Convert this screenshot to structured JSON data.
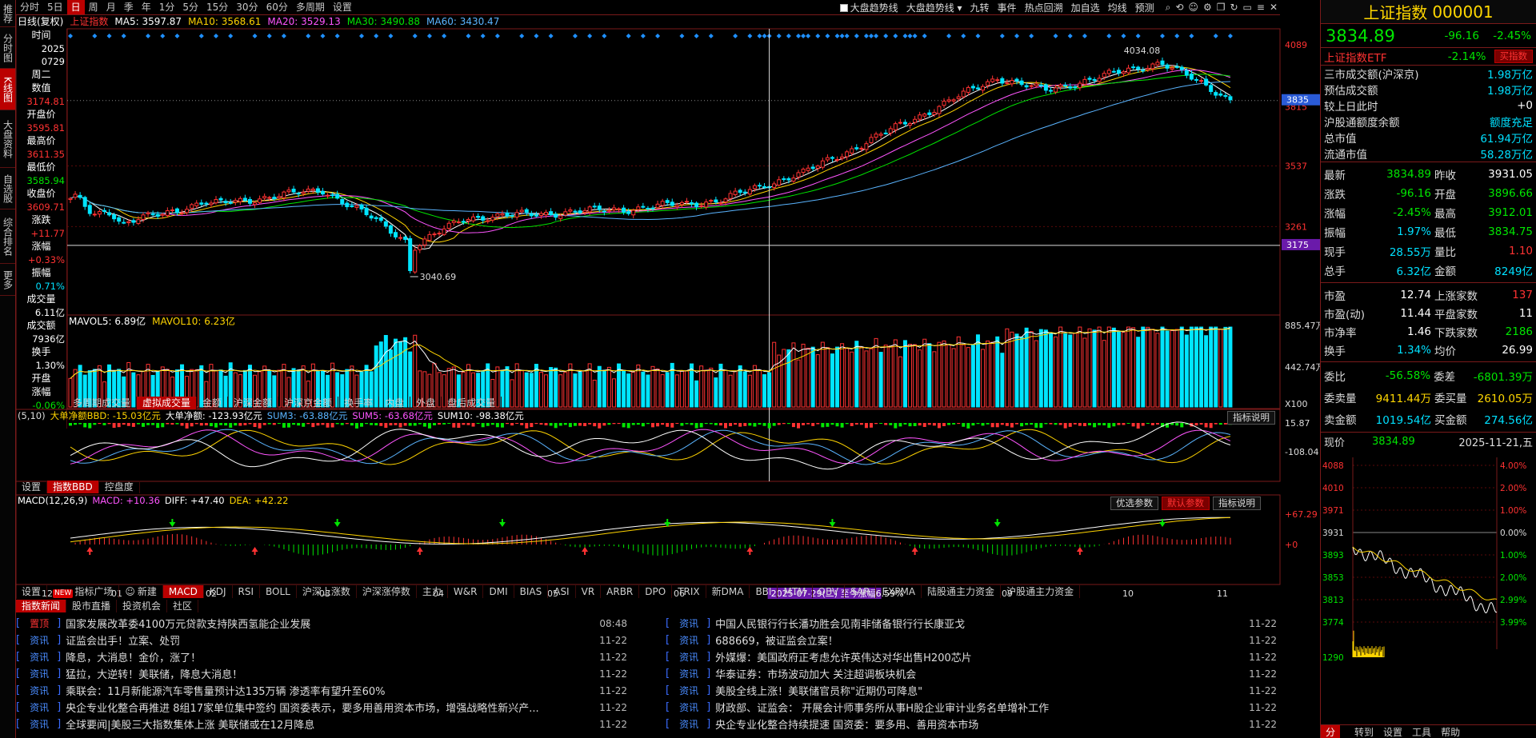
{
  "sidebar_tabs": [
    {
      "label": "推荐",
      "h": 34
    },
    {
      "label": "分时图",
      "h": 52
    },
    {
      "label": "K线图",
      "h": 52,
      "active": true
    },
    {
      "label": "大盘资料",
      "h": 72
    },
    {
      "label": "自选股",
      "h": 52
    },
    {
      "label": "综合排名",
      "h": 68
    },
    {
      "label": "更多",
      "h": 40
    }
  ],
  "toolbar": {
    "periods": [
      "分时",
      "5日",
      "日",
      "周",
      "月",
      "季",
      "年",
      "1分",
      "5分",
      "15分",
      "30分",
      "60分",
      "多周期",
      "设置"
    ],
    "active_period": "日",
    "right_items": [
      "大盘趋势线",
      "大盘趋势线",
      "九转",
      "事件",
      "热点回溯",
      "加自选",
      "均线",
      "预测"
    ],
    "checkbox_label": "大盘趋势线",
    "icons": [
      "search-icon",
      "history-icon",
      "smile-icon",
      "settings-icon",
      "copy-icon",
      "refresh-icon",
      "screen-icon",
      "lines-icon",
      "close-icon"
    ]
  },
  "kline": {
    "period_label": "日线(复权)",
    "index_label": "上证指数",
    "ma": [
      {
        "label": "MA5: 3597.87",
        "color": "#ffffff"
      },
      {
        "label": "MA10: 3568.61",
        "color": "#ffd400"
      },
      {
        "label": "MA20: 3529.13",
        "color": "#ff55ff"
      },
      {
        "label": "MA30: 3490.88",
        "color": "#00e600"
      },
      {
        "label": "MA60: 3430.47",
        "color": "#5ab4ff"
      }
    ],
    "price_labels": [
      "4089",
      "3537",
      "3261"
    ],
    "current_price_tag": "3835",
    "cursor_price_tag": "3175",
    "extra_price_label": "3815",
    "low_label": "3040.69",
    "high_label": "4034.08",
    "x_labels": [
      "12",
      "01",
      "02",
      "03",
      "04",
      "05",
      "06",
      "07",
      "09",
      "10",
      "11"
    ],
    "period_change_label": "2025-07-29(二) 至今涨幅6.59%"
  },
  "stock_info": {
    "items": [
      {
        "l": "时间",
        "v": "2025",
        "c": "white"
      },
      {
        "l": "",
        "v": "0729",
        "c": "white"
      },
      {
        "l": "周二",
        "v": "",
        "c": "white"
      },
      {
        "l": "数值",
        "v": "3174.81",
        "c": "red"
      },
      {
        "l": "开盘价",
        "v": "3595.81",
        "c": "red"
      },
      {
        "l": "最高价",
        "v": "3611.35",
        "c": "red"
      },
      {
        "l": "最低价",
        "v": "3585.94",
        "c": "green"
      },
      {
        "l": "收盘价",
        "v": "3609.71",
        "c": "red"
      },
      {
        "l": "涨跌",
        "v": "+11.77",
        "c": "red"
      },
      {
        "l": "涨幅",
        "v": "+0.33%",
        "c": "red"
      },
      {
        "l": "振幅",
        "v": "0.71%",
        "c": "cyan"
      },
      {
        "l": "成交量",
        "v": "6.11亿",
        "c": "white"
      },
      {
        "l": "成交额",
        "v": "7936亿",
        "c": "white"
      },
      {
        "l": "换手",
        "v": "1.30%",
        "c": "white"
      },
      {
        "l": "开盘",
        "v": "",
        "c": "white"
      },
      {
        "l": "涨幅",
        "v": "-0.06%",
        "c": "green"
      }
    ]
  },
  "volume": {
    "legend": [
      {
        "label": "MAVOL5: 6.89亿",
        "color": "#ffffff"
      },
      {
        "label": "MAVOL10: 6.23亿",
        "color": "#ffd400"
      }
    ],
    "axis": [
      "885.47万",
      "442.74万",
      "X100"
    ]
  },
  "vol_tabs": {
    "items": [
      "多周期成交量",
      "虚拟成交量",
      "金额",
      "沪深金额",
      "沪深京金额",
      "换手率",
      "内盘",
      "外盘",
      "盘后成交量"
    ],
    "active": "虚拟成交量"
  },
  "bbd": {
    "params": "(5,10)",
    "legend": [
      {
        "label": "大单净额BBD: -15.03亿元",
        "color": "#ffd400"
      },
      {
        "label": "大单净额: -123.93亿元",
        "color": "#ffffff"
      },
      {
        "label": "SUM3: -63.88亿元",
        "color": "#5ab4ff"
      },
      {
        "label": "SUM5: -63.68亿元",
        "color": "#ff55ff"
      },
      {
        "label": "SUM10: -98.38亿元",
        "color": "#ffffff"
      }
    ],
    "axis": [
      "15.87",
      "-108.04"
    ],
    "explain": "指标说明"
  },
  "bbd_tabs": {
    "items": [
      "设置",
      "指数BBD",
      "控盘度"
    ],
    "active": "指数BBD"
  },
  "macd": {
    "legend": [
      {
        "label": "MACD(12,26,9)",
        "color": "#ffffff"
      },
      {
        "label": "MACD: +10.36",
        "color": "#ff55ff"
      },
      {
        "label": "DIFF: +47.40",
        "color": "#ffffff"
      },
      {
        "label": "DEA: +42.22",
        "color": "#ffd400"
      }
    ],
    "axis": [
      "+67.29",
      "+0"
    ],
    "buttons": [
      "优选参数",
      "默认参数",
      "指标说明"
    ]
  },
  "indicator_tabs": {
    "items": [
      "设置",
      "指标广场",
      "新建",
      "MACD",
      "KDJ",
      "RSI",
      "BOLL",
      "沪深上涨数",
      "沪深涨停数",
      "主力",
      "W&R",
      "DMI",
      "BIAS",
      "ASI",
      "VR",
      "ARBR",
      "DPO",
      "TRIX",
      "新DMA",
      "BBI",
      "MTM",
      "OBV",
      "SAR",
      "EXPMA",
      "陆股通主力资金",
      "沪股通主力资金"
    ],
    "active": "MACD",
    "new_badge": "NEW"
  },
  "news_tabs": {
    "items": [
      "指数新闻",
      "股市直播",
      "投资机会",
      "社区"
    ],
    "active": "指数新闻"
  },
  "news_left": [
    {
      "tag": "置顶",
      "title": "国家发展改革委4100万元贷款支持陕西氢能企业发展",
      "date": "08:48",
      "red": true
    },
    {
      "tag": "资讯",
      "title": "证监会出手！立案、处罚",
      "date": "11-22"
    },
    {
      "tag": "资讯",
      "title": "降息，大消息！金价，涨了！",
      "date": "11-22"
    },
    {
      "tag": "资讯",
      "title": "猛拉，大逆转！美联储，降息大消息！",
      "date": "11-22"
    },
    {
      "tag": "资讯",
      "title": "乘联会：11月新能源汽车零售量预计达135万辆 渗透率有望升至60%",
      "date": "11-22"
    },
    {
      "tag": "资讯",
      "title": "央企专业化整合再推进 8组17家单位集中签约 国资委表示，要多用善用资本市场，增强战略性新兴产...",
      "date": "11-22"
    },
    {
      "tag": "资讯",
      "title": "全球要闻|美股三大指数集体上涨 美联储或在12月降息",
      "date": "11-22"
    }
  ],
  "news_right": [
    {
      "tag": "资讯",
      "title": "中国人民银行行长潘功胜会见南非储备银行行长康亚戈",
      "date": "11-22"
    },
    {
      "tag": "资讯",
      "title": "688669，被证监会立案！",
      "date": "11-22"
    },
    {
      "tag": "资讯",
      "title": "外媒爆：美国政府正考虑允许英伟达对华出售H200芯片",
      "date": "11-22"
    },
    {
      "tag": "资讯",
      "title": "华泰证券：市场波动加大 关注超调板块机会",
      "date": "11-22"
    },
    {
      "tag": "资讯",
      "title": "美股全线上涨！美联储官员称\"近期仍可降息\"",
      "date": "11-22"
    },
    {
      "tag": "资讯",
      "title": "财政部、证监会： 开展会计师事务所从事H股企业审计业务名单增补工作",
      "date": "11-22"
    },
    {
      "tag": "资讯",
      "title": "央企专业化整合持续提速 国资委：要多用、善用资本市场",
      "date": "11-22"
    }
  ],
  "right_panel": {
    "title": "上证指数",
    "code": "000001",
    "price": "3834.89",
    "change": "-96.16",
    "pct": "-2.45%",
    "etf_name": "上证指数ETF",
    "etf_pct": "-2.14%",
    "buy_btn": "买指数",
    "stats1": [
      {
        "l": "三市成交额(沪深京)",
        "v": "1.98万亿",
        "c": "cyan"
      },
      {
        "l": "预估成交额",
        "v": "1.98万亿",
        "c": "cyan"
      },
      {
        "l": "较上日此时",
        "v": "+0",
        "c": "white"
      },
      {
        "l": "沪股通额度余额",
        "v": "额度充足",
        "c": "cyan"
      },
      {
        "l": "总市值",
        "v": "61.94万亿",
        "c": "cyan"
      },
      {
        "l": "流通市值",
        "v": "58.28万亿",
        "c": "cyan"
      }
    ],
    "grid1": [
      [
        "最新",
        "3834.89",
        "green",
        "昨收",
        "3931.05",
        "white"
      ],
      [
        "涨跌",
        "-96.16",
        "green",
        "开盘",
        "3896.66",
        "green"
      ],
      [
        "涨幅",
        "-2.45%",
        "green",
        "最高",
        "3912.01",
        "green"
      ],
      [
        "振幅",
        "1.97%",
        "cyan",
        "最低",
        "3834.75",
        "green"
      ],
      [
        "现手",
        "28.55万",
        "cyan",
        "量比",
        "1.10",
        "red"
      ],
      [
        "总手",
        "6.32亿",
        "cyan",
        "金额",
        "8249亿",
        "cyan"
      ]
    ],
    "grid2": [
      [
        "市盈",
        "12.74",
        "white",
        "上涨家数",
        "137",
        "red"
      ],
      [
        "市盈(动)",
        "11.44",
        "white",
        "平盘家数",
        "11",
        "white"
      ],
      [
        "市净率",
        "1.46",
        "white",
        "下跌家数",
        "2186",
        "green"
      ],
      [
        "换手",
        "1.34%",
        "cyan",
        "均价",
        "26.99",
        "white"
      ]
    ],
    "grid3": [
      [
        "委比",
        "-56.58%",
        "green",
        "委差",
        "-6801.39万",
        "green"
      ],
      [
        "委卖量",
        "9411.44万",
        "yellow",
        "委买量",
        "2610.05万",
        "yellow"
      ],
      [
        "卖金额",
        "1019.54亿",
        "cyan",
        "买金额",
        "274.56亿",
        "cyan"
      ]
    ],
    "intraday": {
      "label": "现价",
      "price": "3834.89",
      "date": "2025-11-21,五",
      "left_axis": [
        "4088",
        "4010",
        "3971",
        "3931",
        "3893",
        "3853",
        "3813",
        "3774",
        "1290"
      ],
      "right_axis": [
        "4.00%",
        "2.00%",
        "1.00%",
        "0.00%",
        "1.00%",
        "2.00%",
        "2.99%",
        "3.99%"
      ]
    },
    "bottom_items": [
      "分",
      "",
      "转到",
      "设置",
      "工具",
      "帮助"
    ]
  },
  "colors": {
    "up": "#ff3232",
    "down": "#00e5ff",
    "bg": "#000000",
    "border": "#7a1a1a",
    "tab_active": "#bb0000"
  }
}
